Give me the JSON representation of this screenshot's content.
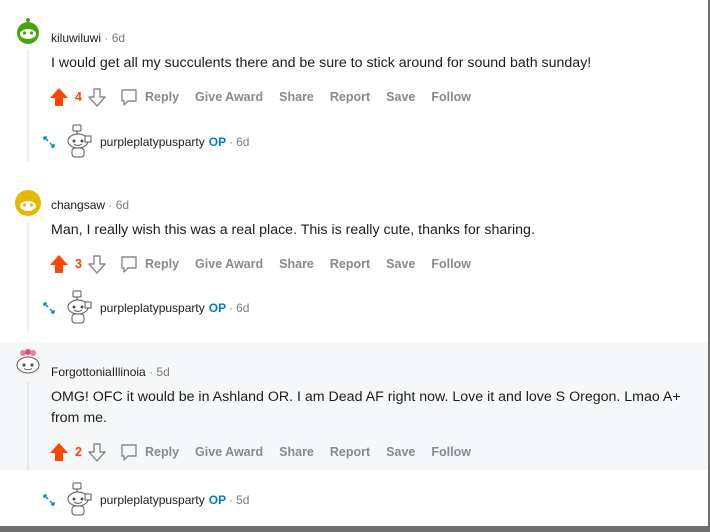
{
  "actions": {
    "reply": "Reply",
    "give_award": "Give Award",
    "share": "Share",
    "report": "Report",
    "save": "Save",
    "follow": "Follow"
  },
  "comments": [
    {
      "username": "kiluwiluwi",
      "separator": "·",
      "age": "6d",
      "body": "I would get all my succulents there and be sure to stick around for sound bath sunday!",
      "votes": "4",
      "reply": {
        "username": "purpleplatypusparty",
        "badge": "OP",
        "separator": "·",
        "age": "6d"
      }
    },
    {
      "username": "changsaw",
      "separator": "·",
      "age": "6d",
      "body": "Man, I really wish this was a real place. This is really cute, thanks for sharing.",
      "votes": "3",
      "reply": {
        "username": "purpleplatypusparty",
        "badge": "OP",
        "separator": "·",
        "age": "6d"
      }
    },
    {
      "username": "ForgottoniaIllinoia",
      "separator": "·",
      "age": "5d",
      "body": "OMG! OFC it would be in Ashland OR. I am Dead AF right now. Love it and love S Oregon. Lmao A+ from me.",
      "votes": "2",
      "reply": {
        "username": "purpleplatypusparty",
        "badge": "OP",
        "separator": "·",
        "age": "5d"
      }
    }
  ],
  "colors": {
    "upvote": "#ff4500",
    "op_badge": "#0079d3",
    "muted": "#878a8c"
  },
  "icons": [
    "upvote-arrow-icon",
    "downvote-arrow-icon",
    "speech-bubble-icon",
    "expand-arrows-icon",
    "snoo-avatar-icon"
  ]
}
